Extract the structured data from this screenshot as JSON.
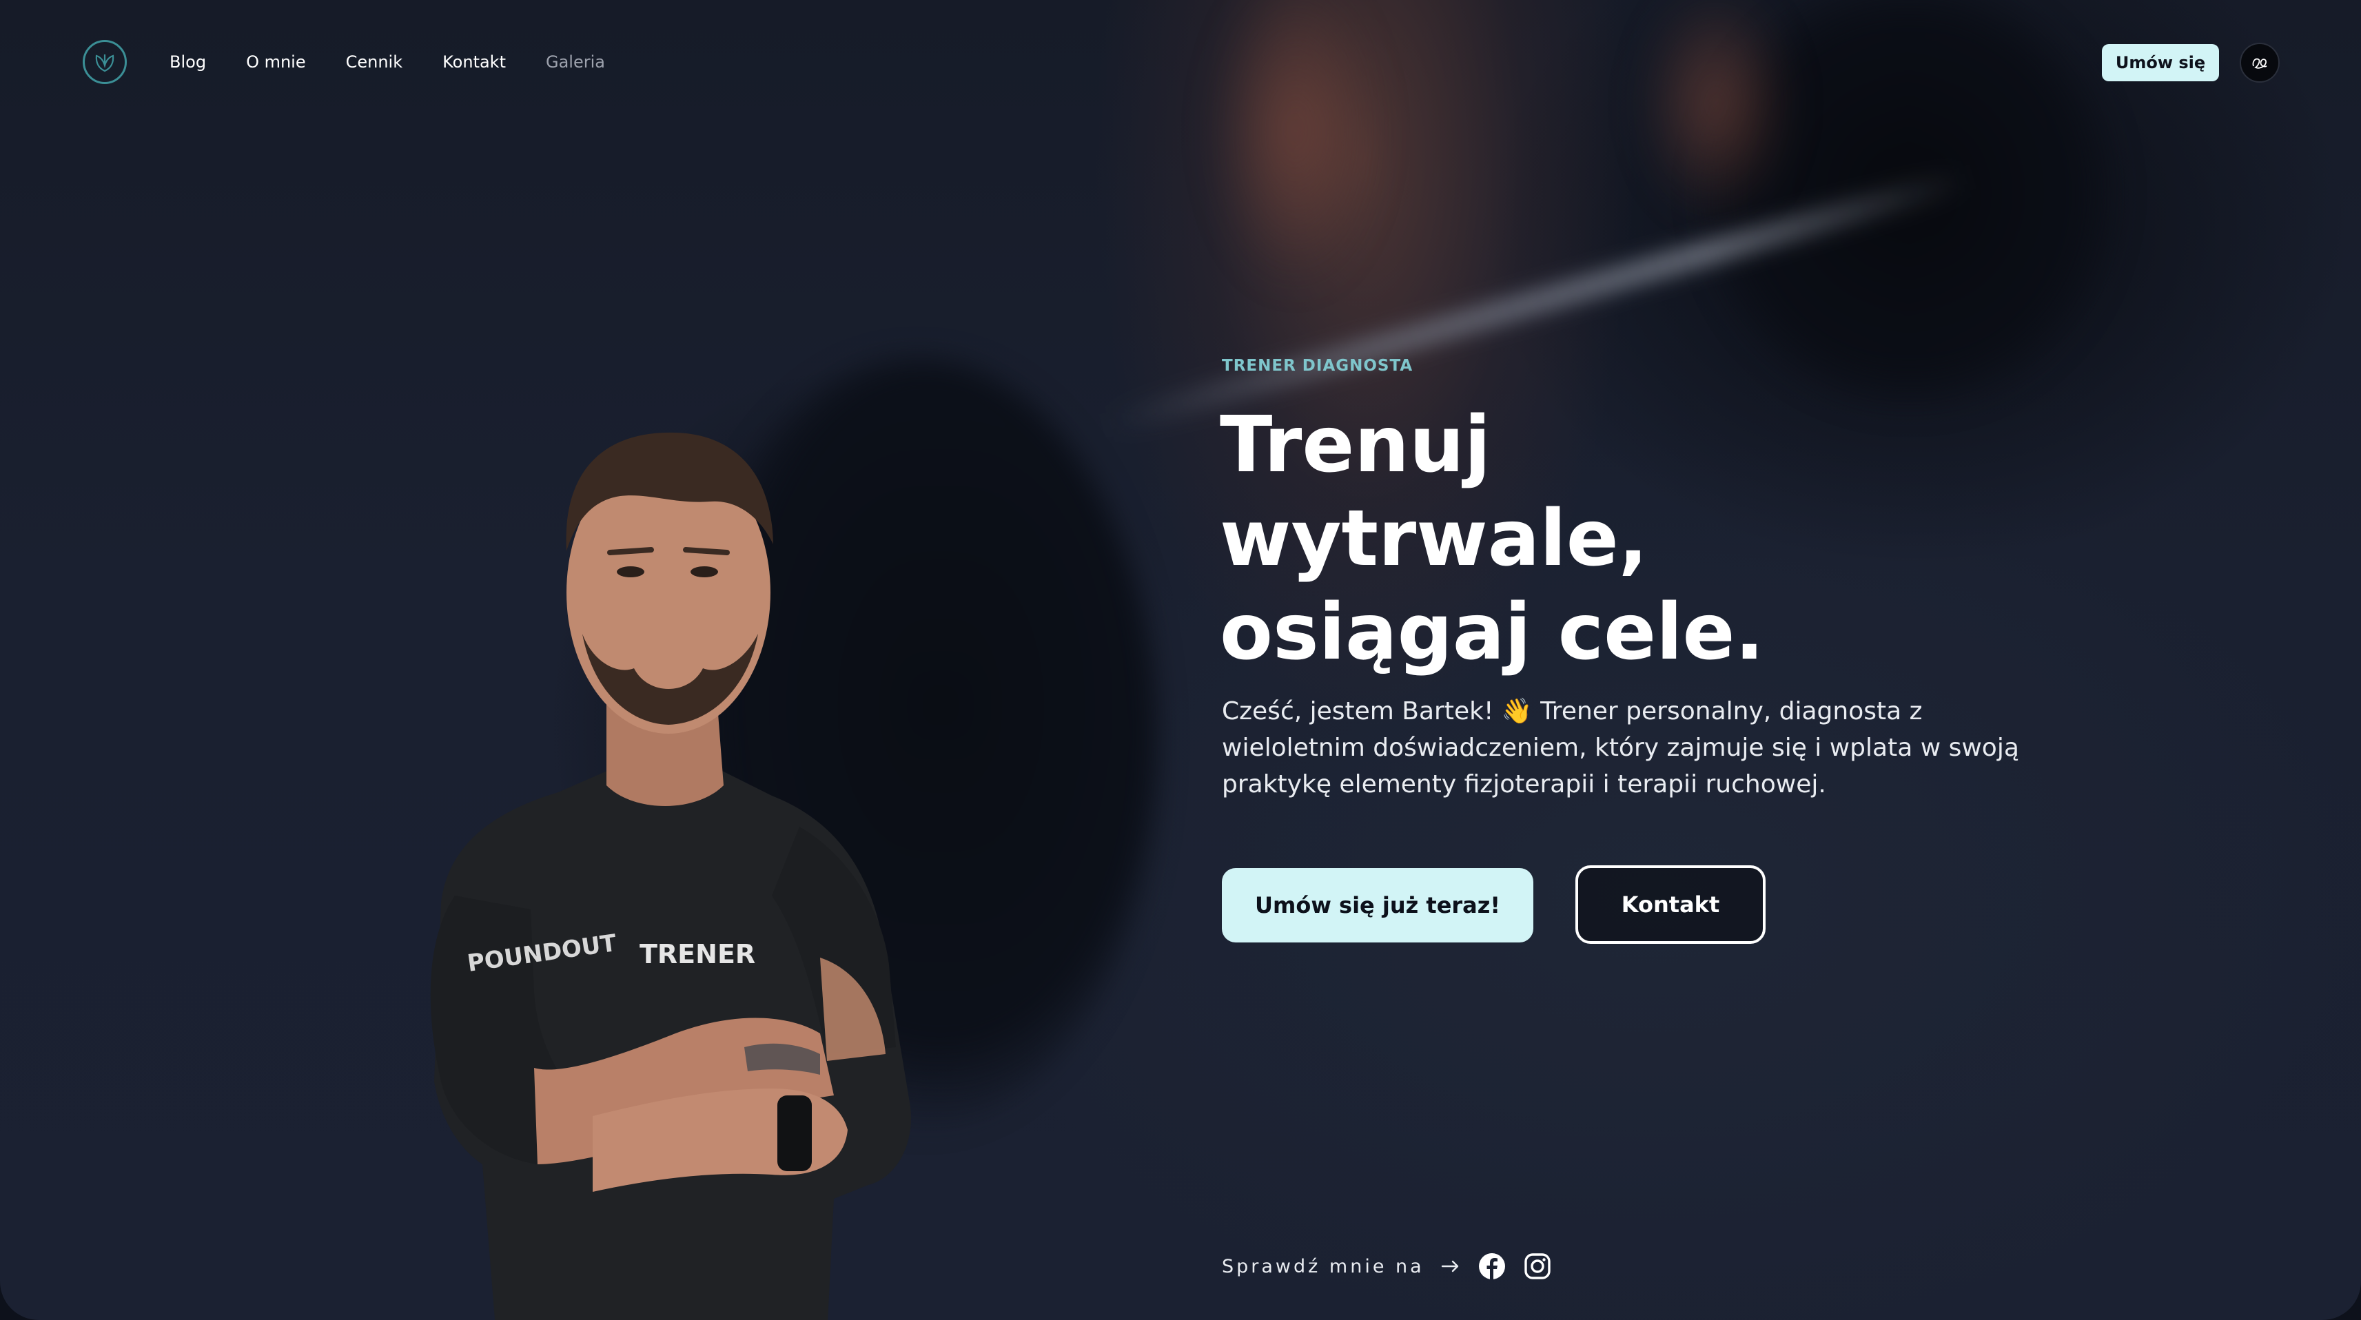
{
  "nav": {
    "links": [
      {
        "label": "Blog"
      },
      {
        "label": "O mnie"
      },
      {
        "label": "Cennik"
      },
      {
        "label": "Kontakt"
      },
      {
        "label": "Galeria"
      }
    ],
    "cta_label": "Umów się",
    "logo_icon": "leaf-monogram-icon",
    "lang_icon": "monogram-toggle-icon"
  },
  "hero": {
    "eyebrow": "TRENER DIAGNOSTA",
    "headline_lines": [
      "Trenuj",
      "wytrwale,",
      "osiągaj cele."
    ],
    "intro": "Cześć, jestem Bartek! 👋 Trener personalny, diagnosta z wieloletnim doświadczeniem, który zajmuje się i wplata w swoją praktykę elementy fizjoterapii i terapii ruchowej.",
    "primary_button": "Umów się już teraz!",
    "secondary_button": "Kontakt",
    "shirt_text": "TRENER",
    "shirt_brand": "POUNDOUT"
  },
  "social": {
    "label": "Sprawdź mnie na",
    "icons": [
      "arrow-right-icon",
      "facebook-icon",
      "instagram-icon"
    ]
  },
  "colors": {
    "accent": "#d2f4f6",
    "eyebrow": "#7fc6cc",
    "background": "#1a2030",
    "text": "#ffffff"
  }
}
